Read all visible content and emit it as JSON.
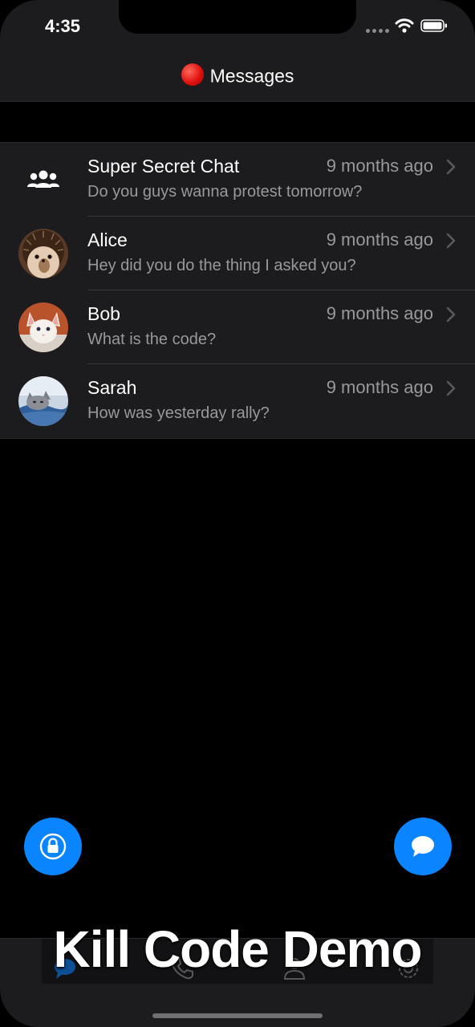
{
  "status_bar": {
    "time": "4:35"
  },
  "nav": {
    "title": "Messages"
  },
  "chats": [
    {
      "name": "Super Secret Chat",
      "time": "9 months ago",
      "preview": "Do you guys wanna protest tomorrow?",
      "avatar": "group-icon"
    },
    {
      "name": "Alice",
      "time": "9 months ago",
      "preview": "Hey did you do the thing I asked you?",
      "avatar": "hedgehog-avatar"
    },
    {
      "name": "Bob",
      "time": "9 months ago",
      "preview": "What is the code?",
      "avatar": "kitten-avatar"
    },
    {
      "name": "Sarah",
      "time": "9 months ago",
      "preview": "How was yesterday rally?",
      "avatar": "cat-avatar"
    }
  ],
  "fab": {
    "left_icon": "lock-icon",
    "right_icon": "chat-bubble-icon"
  },
  "tab_bar": {
    "icons": [
      "messages-tab-icon",
      "calls-tab-icon",
      "contacts-tab-icon",
      "settings-tab-icon"
    ]
  },
  "caption": "Kill Code Demo",
  "colors": {
    "accent": "#0a84ff",
    "background": "#000000",
    "surface": "#1c1c1e",
    "secondary_text": "#98989e",
    "record_dot": "#e01111"
  }
}
